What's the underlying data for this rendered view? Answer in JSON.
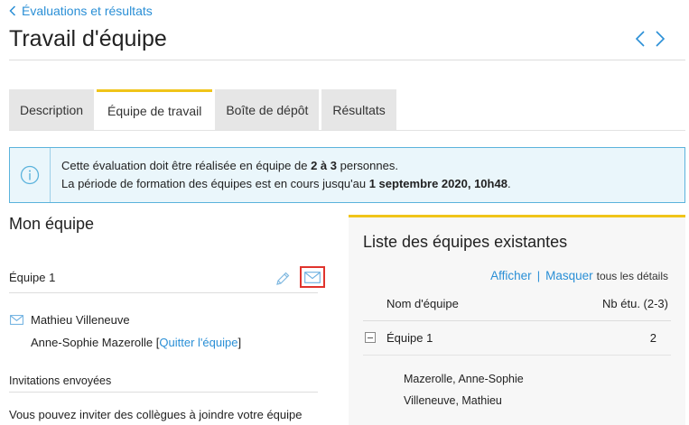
{
  "header": {
    "breadcrumb": "Évaluations et résultats",
    "title": "Travail d'équipe"
  },
  "tabs": [
    {
      "label": "Description",
      "active": false
    },
    {
      "label": "Équipe de travail",
      "active": true
    },
    {
      "label": "Boîte de dépôt",
      "active": false
    },
    {
      "label": "Résultats",
      "active": false
    }
  ],
  "info": {
    "line1_prefix": "Cette évaluation doit être réalisée en équipe de ",
    "line1_bold": "2 à 3",
    "line1_suffix": " personnes.",
    "line2_prefix": "La période de formation des équipes est en cours jusqu'au ",
    "line2_bold": "1 septembre 2020, 10h48",
    "line2_suffix": "."
  },
  "my_team": {
    "section_title": "Mon équipe",
    "team_name": "Équipe 1",
    "members": [
      {
        "name": "Mathieu Villeneuve"
      },
      {
        "name": "Anne-Sophie Mazerolle"
      }
    ],
    "quit_open": "[",
    "quit_label": "Quitter l'équipe",
    "quit_close": "]",
    "invites_label": "Invitations envoyées",
    "invites_text": "Vous pouvez inviter des collègues à joindre votre équipe"
  },
  "existing_teams": {
    "title": "Liste des équipes existantes",
    "show_label": "Afficher",
    "separator": "|",
    "hide_label": "Masquer",
    "details_label": "tous les détails",
    "col_name": "Nom d'équipe",
    "col_count": "Nb étu. (2-3)",
    "teams": [
      {
        "name": "Équipe 1",
        "count": "2",
        "members": [
          "Mazerolle, Anne-Sophie",
          "Villeneuve, Mathieu"
        ]
      }
    ]
  },
  "colors": {
    "link": "#2a8fd6",
    "accent": "#f0c419",
    "info_bg": "#eaf6fb",
    "info_border": "#5bb3dc",
    "highlight": "#e0342d"
  },
  "icons": [
    "chevron-left-icon",
    "chevron-right-icon",
    "info-icon",
    "pencil-icon",
    "envelope-icon",
    "collapse-icon"
  ]
}
